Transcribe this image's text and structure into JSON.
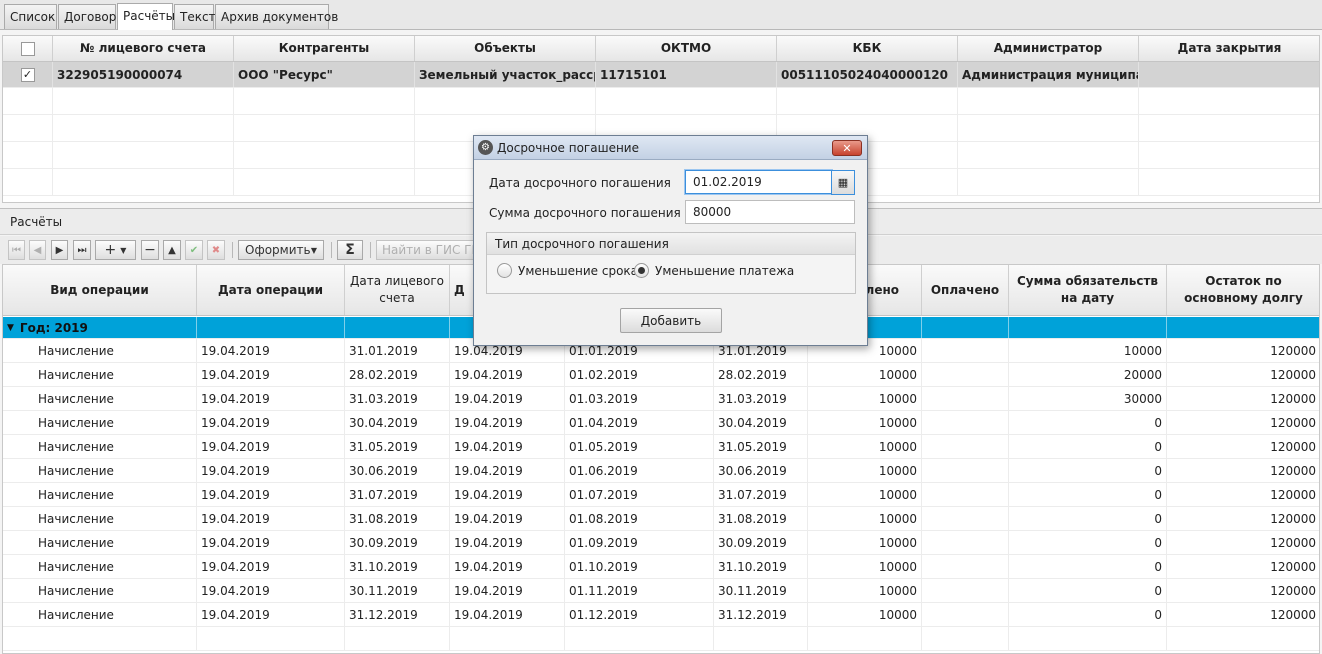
{
  "tabs": [
    {
      "label": "Список"
    },
    {
      "label": "Договор"
    },
    {
      "label": "Расчёты"
    },
    {
      "label": "Текст"
    },
    {
      "label": "Архив документов"
    }
  ],
  "accounts_table": {
    "headers": [
      "№ лицевого счета",
      "Контрагенты",
      "Объекты",
      "ОКТМО",
      "КБК",
      "Администратор",
      "Дата закрытия"
    ],
    "selected_row": {
      "checked": "✓",
      "cells": [
        "322905190000074",
        "ООО \"Ресурс\"",
        "Земельный участок_рассро...",
        "11715101",
        "00511105024040000120",
        "Администрация муниципа...",
        ""
      ]
    }
  },
  "section_title": "Расчёты",
  "toolbar": {
    "oformit_label": "Оформить",
    "gis_label": "Найти в ГИС ГМП",
    "sum_symbol": "Σ"
  },
  "calc_table": {
    "headers": [
      "Вид операции",
      "Дата операции",
      "Дата лицевого счета",
      "Д",
      "",
      "",
      "лено",
      "Оплачено",
      "Сумма обязательств на дату",
      "Остаток по основному долгу"
    ],
    "group_label": "Год: 2019",
    "rows": [
      [
        "Начисление",
        "19.04.2019",
        "31.01.2019",
        "19.04.2019",
        "01.01.2019",
        "31.01.2019",
        "10000",
        "",
        "10000",
        "120000"
      ],
      [
        "Начисление",
        "19.04.2019",
        "28.02.2019",
        "19.04.2019",
        "01.02.2019",
        "28.02.2019",
        "10000",
        "",
        "20000",
        "120000"
      ],
      [
        "Начисление",
        "19.04.2019",
        "31.03.2019",
        "19.04.2019",
        "01.03.2019",
        "31.03.2019",
        "10000",
        "",
        "30000",
        "120000"
      ],
      [
        "Начисление",
        "19.04.2019",
        "30.04.2019",
        "19.04.2019",
        "01.04.2019",
        "30.04.2019",
        "10000",
        "",
        "0",
        "120000"
      ],
      [
        "Начисление",
        "19.04.2019",
        "31.05.2019",
        "19.04.2019",
        "01.05.2019",
        "31.05.2019",
        "10000",
        "",
        "0",
        "120000"
      ],
      [
        "Начисление",
        "19.04.2019",
        "30.06.2019",
        "19.04.2019",
        "01.06.2019",
        "30.06.2019",
        "10000",
        "",
        "0",
        "120000"
      ],
      [
        "Начисление",
        "19.04.2019",
        "31.07.2019",
        "19.04.2019",
        "01.07.2019",
        "31.07.2019",
        "10000",
        "",
        "0",
        "120000"
      ],
      [
        "Начисление",
        "19.04.2019",
        "31.08.2019",
        "19.04.2019",
        "01.08.2019",
        "31.08.2019",
        "10000",
        "",
        "0",
        "120000"
      ],
      [
        "Начисление",
        "19.04.2019",
        "30.09.2019",
        "19.04.2019",
        "01.09.2019",
        "30.09.2019",
        "10000",
        "",
        "0",
        "120000"
      ],
      [
        "Начисление",
        "19.04.2019",
        "31.10.2019",
        "19.04.2019",
        "01.10.2019",
        "31.10.2019",
        "10000",
        "",
        "0",
        "120000"
      ],
      [
        "Начисление",
        "19.04.2019",
        "30.11.2019",
        "19.04.2019",
        "01.11.2019",
        "30.11.2019",
        "10000",
        "",
        "0",
        "120000"
      ],
      [
        "Начисление",
        "19.04.2019",
        "31.12.2019",
        "19.04.2019",
        "01.12.2019",
        "31.12.2019",
        "10000",
        "",
        "0",
        "120000"
      ]
    ]
  },
  "dialog": {
    "title": "Досрочное погашение",
    "close_symbol": "✕",
    "date_label": "Дата досрочного погашения",
    "date_value": "01.02.2019",
    "sum_label": "Сумма досрочного погашения",
    "sum_value": "80000",
    "type_label": "Тип досрочного погашения",
    "option_term": "Уменьшение срока",
    "option_payment": "Уменьшение платежа",
    "selected_option": "Уменьшение платежа",
    "add_label": "Добавить"
  },
  "colors": {
    "group_row": "#00a2d9",
    "selected_row": "#d3d3d3",
    "dialog_title": "#c3d1e4",
    "close_button": "#c7432e"
  }
}
